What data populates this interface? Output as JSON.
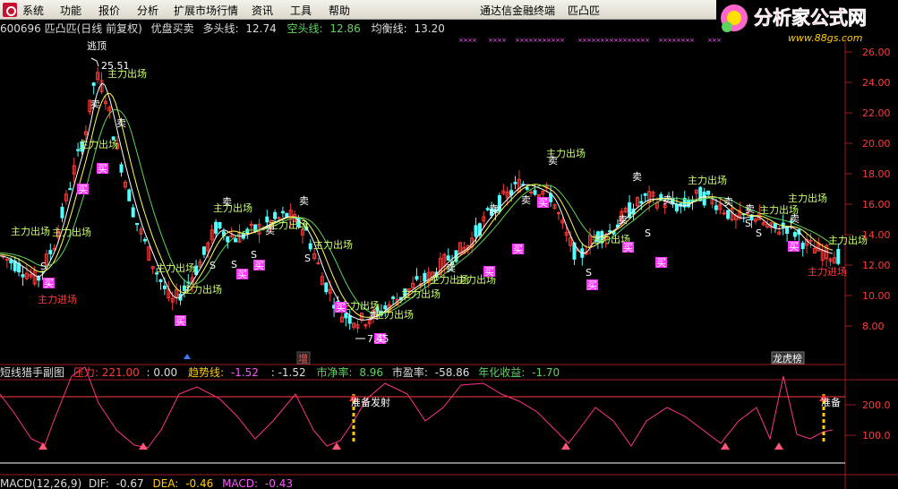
{
  "menu": {
    "items": [
      "系统",
      "功能",
      "报价",
      "分析",
      "扩展市场行情",
      "资讯",
      "工具",
      "帮助"
    ],
    "terminal_title": "通达信金融终端",
    "stock_name": "匹凸匹"
  },
  "watermark": {
    "site_name": "分析家公式网",
    "url": "www.88gs.com"
  },
  "info": {
    "code_name": "600696 匹凸匹(日线 前复权)",
    "indicator": "优盘买卖",
    "bull_label": "多头线:",
    "bull_value": "12.74",
    "bear_label": "空头线:",
    "bear_value": "12.86",
    "avg_label": "均衡线:",
    "avg_value": "13.20"
  },
  "price_axis": {
    "ticks": [
      "26.00",
      "24.00",
      "22.00",
      "20.00",
      "18.00",
      "16.00",
      "14.00",
      "12.00",
      "10.00",
      "8.00"
    ]
  },
  "annotations": {
    "escape_top": "逃顶",
    "high_price": "25.51",
    "low_price": "7.45",
    "main_exit": "主力出场",
    "main_enter": "主力进场",
    "buy": "买",
    "sell": "卖",
    "s_mark": "S",
    "increase_tag": "增",
    "rank_tag": "龙虎榜"
  },
  "indicator_panel": {
    "name": "短线猎手副图",
    "pressure_label": "压力:",
    "pressure_value": "221.00",
    "value2": ": 0.00",
    "trend_label": "趋势线:",
    "trend_value": "-1.52",
    "value4": ": -1.52",
    "netrate_label": "市净率:",
    "netrate_value": "8.96",
    "pe_label": "市盈率:",
    "pe_value": "-58.86",
    "yield_label": "年化收益:",
    "yield_value": "-1.70",
    "ready_signal": "准备发射",
    "ready_partial": "准备",
    "axis_ticks": [
      "200.0",
      "100.0"
    ]
  },
  "macd": {
    "name": "MACD(12,26,9)",
    "dif_label": "DIF:",
    "dif_value": "-0.67",
    "dea_label": "DEA:",
    "dea_value": "-0.46",
    "macd_label": "MACD:",
    "macd_value": "-0.43"
  },
  "colors": {
    "up": "#ff3b3b",
    "down": "#54ffff",
    "bull_line": "#ffffff",
    "bear_line": "#ffff55",
    "avg_line": "#ff55ff",
    "exit_text": "#c8ff64",
    "enter_text": "#ff3b3b",
    "buy_bg": "#ff33ff",
    "osc_up": "#ff3388",
    "osc_down": "#54c8ff"
  }
}
